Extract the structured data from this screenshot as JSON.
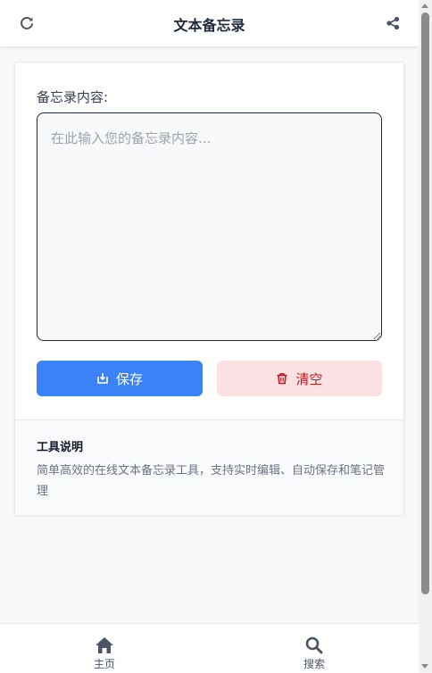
{
  "header": {
    "title": "文本备忘录",
    "refresh_icon": "refresh-icon",
    "share_icon": "share-icon"
  },
  "form": {
    "label": "备忘录内容:",
    "placeholder": "在此输入您的备忘录内容...",
    "value": ""
  },
  "actions": {
    "save_label": "保存",
    "save_icon": "save-icon",
    "clear_label": "清空",
    "clear_icon": "trash-icon"
  },
  "help": {
    "title": "工具说明",
    "description": "简单高效的在线文本备忘录工具，支持实时编辑、自动保存和笔记管理"
  },
  "nav": {
    "items": [
      {
        "label": "主页",
        "icon": "home-icon"
      },
      {
        "label": "搜索",
        "icon": "search-icon"
      }
    ]
  },
  "colors": {
    "primary": "#3b82f6",
    "danger_bg": "#fde2e4",
    "danger_text": "#b91c1c",
    "icon": "#4b5563"
  }
}
